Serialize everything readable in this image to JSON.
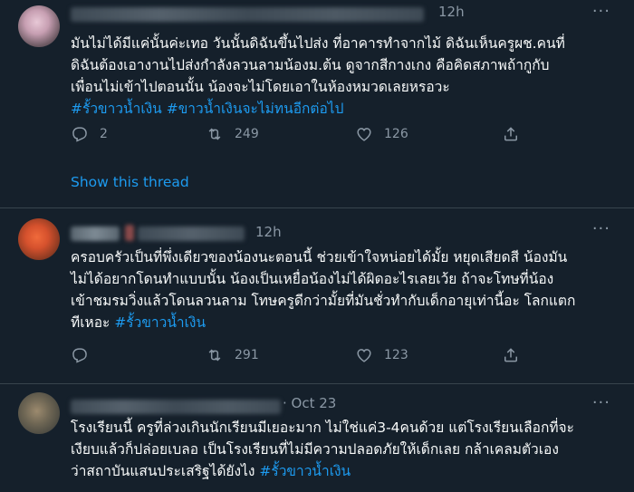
{
  "tweets": [
    {
      "timestamp": "12h",
      "lines": [
        "มันไม่ได้มีแค่นั้นค่ะเทอ วันนั้นดิฉันขึ้นไปส่ง ที่อาคารทำจากไม้ ดิฉันเห็นครูผช.คนที่",
        "ดิฉันต้องเอางานไปส่งกำลังลวนลามน้องม.ต้น ดูจากสีกางเกง คือคิดสภาพถ้ากูกับ",
        "เพื่อนไม่เข้าไปตอนนั้น น้องจะไม่โดยเอาในห้องหมวดเลยหรอวะ"
      ],
      "hashtags": [
        "#รั้วขาวน้ำเงิน",
        "#ขาวน้ำเงินจะไม่ทนอีกต่อไป"
      ],
      "replies": "2",
      "retweets": "249",
      "likes": "126",
      "show_thread": "Show this thread"
    },
    {
      "timestamp": "12h",
      "lines": [
        "ครอบครัวเป็นที่พึ่งเดียวของน้องนะตอนนี้ ช่วยเข้าใจหน่อยได้มั้ย หยุดเสียดสี น้องมัน",
        "ไม่ได้อยากโดนทำแบบนั้น น้องเป็นเหยื่อน้องไม่ได้ผิดอะไรเลยเว้ย ถ้าจะโทษที่น้อง",
        "เข้าชมรมวิ่งแล้วโดนลวนลาม โทษครูดีกว่ามั้ยที่มันชั่วทำกับเด็กอายุเท่านี้อะ โลกแตก",
        "ทีเหอะ"
      ],
      "hashtags": [
        "#รั้วขาวน้ำเงิน"
      ],
      "replies": "",
      "retweets": "291",
      "likes": "123"
    },
    {
      "timestamp": "· Oct 23",
      "lines": [
        "โรงเรียนนี้ ครูที่ล่วงเกินนักเรียนมีเยอะมาก ไม่ใช่แค่3-4คนด้วย แต่โรงเรียนเลือกที่จะ",
        "เงียบแล้วก็ปล่อยเบลอ เป็นโรงเรียนที่ไม่มีความปลอดภัยให้เด็กเลย กล้าเคลมตัวเอง",
        "ว่าสถาบันแสนประเสริฐได้ยังไง"
      ],
      "hashtags": [
        "#รั้วขาวน้ำเงิน"
      ]
    }
  ],
  "more_glyph": "···"
}
